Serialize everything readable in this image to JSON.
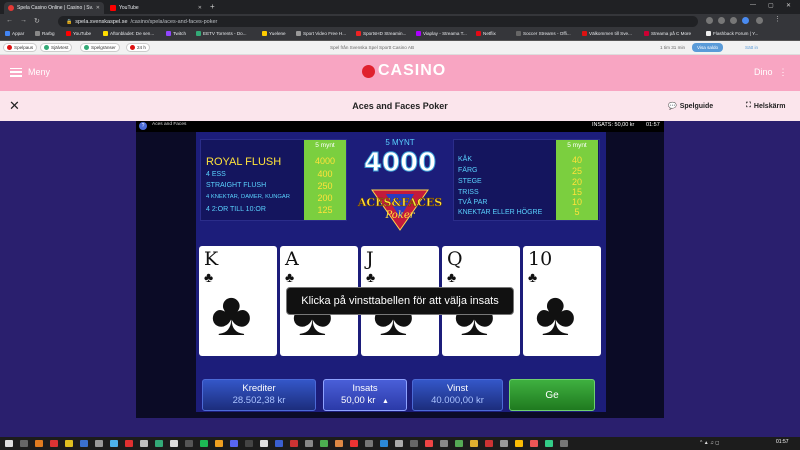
{
  "browser": {
    "tabs": [
      {
        "label": "Spela Casino Online | Casino | Sv...",
        "active": true
      },
      {
        "label": "YouTube",
        "active": false
      }
    ],
    "new_tab": "+",
    "url_host": "spela.svenskaspel.se",
    "url_path": "/casino/spela/aces-and-faces-poker",
    "bookmarks": [
      "Appar",
      "Rarbg",
      "YouTube",
      "Aftonbladet: De sen...",
      "Twitch",
      "EETV Torrents - Do...",
      "Yuelene",
      "Sport Video Free H...",
      "SportsHD Streamin...",
      "Viaplay - Streama T...",
      "Netflix",
      "Soccer Streams - Offi...",
      "Välkommen till Sve...",
      "Streama på C More",
      "Flashback Forum | Y..."
    ]
  },
  "site_strip": {
    "chips": [
      "Spelpaus",
      "Självtest",
      "Spelgränser",
      "24 h"
    ],
    "center": "Spel från Svenska Spel Sportt Casino AB",
    "time": "1 tim 31 min",
    "deposit": "Visa saldo",
    "logout": "Sätt in"
  },
  "header": {
    "menu": "Meny",
    "logo": "CASINO",
    "user": "Dino"
  },
  "gamebar": {
    "title": "Aces and Faces Poker",
    "guide": "Spelguide",
    "fullscreen": "Helskärm"
  },
  "game": {
    "name": "Aces and Faces",
    "insats_top": "INSATS: 50,00 kr",
    "clock": "01:57",
    "coins_label": "5 MYNT",
    "jackpot": "4000",
    "left_table": {
      "header": "5 mynt",
      "rows": [
        {
          "label": "ROYAL FLUSH",
          "value": "4000"
        },
        {
          "label": "4 ESS",
          "value": "400"
        },
        {
          "label": "STRAIGHT FLUSH",
          "value": "250"
        },
        {
          "label": "4 KNEKTAR, DAMER, KUNGAR",
          "value": "200"
        },
        {
          "label": "4 2:OR TILL 10:OR",
          "value": "125"
        }
      ]
    },
    "right_table": {
      "header": "5 mynt",
      "rows": [
        {
          "label": "KÅK",
          "value": "40"
        },
        {
          "label": "FÄRG",
          "value": "25"
        },
        {
          "label": "STEGE",
          "value": "20"
        },
        {
          "label": "TRISS",
          "value": "15"
        },
        {
          "label": "TVÅ PAR",
          "value": "10"
        },
        {
          "label": "KNEKTAR ELLER HÖGRE",
          "value": "5"
        }
      ]
    },
    "logo_top": "ACES",
    "logo_amp": "&",
    "logo_faces": "FACES",
    "logo_sub": "Poker",
    "cards": [
      {
        "rank": "K",
        "suit": "♣"
      },
      {
        "rank": "A",
        "suit": "♣"
      },
      {
        "rank": "J",
        "suit": "♣"
      },
      {
        "rank": "Q",
        "suit": "♣"
      },
      {
        "rank": "10",
        "suit": "♣"
      }
    ],
    "message": "Klicka på vinsttabellen för att välja insats",
    "controls": {
      "credits_label": "Krediter",
      "credits_value": "28.502,38 kr",
      "bet_label": "Insats",
      "bet_value": "50,00 kr",
      "win_label": "Vinst",
      "win_value": "40.000,00 kr",
      "go_label": "Ge"
    }
  },
  "taskbar": {
    "tray": "^ ▲ ♫ ◻",
    "time": "01:57"
  }
}
